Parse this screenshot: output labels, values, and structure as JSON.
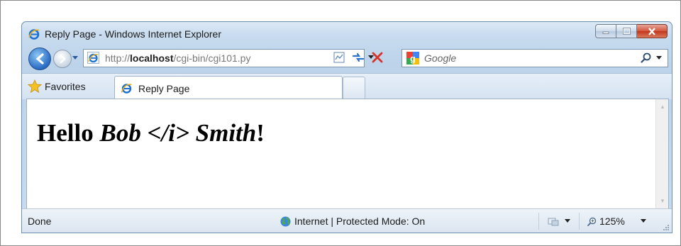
{
  "window": {
    "title": "Reply Page - Windows Internet Explorer"
  },
  "navbar": {
    "url_prefix": "http://",
    "url_host": "localhost",
    "url_path": "/cgi-bin/cgi101.py",
    "search_placeholder": "Google"
  },
  "tabs": {
    "favorites_label": "Favorites",
    "active_tab_label": "Reply Page"
  },
  "content": {
    "heading_start": "Hello ",
    "heading_italic": "Bob </i> Smith",
    "heading_end": "!"
  },
  "statusbar": {
    "status": "Done",
    "zone": "Internet | Protected Mode: On",
    "zoom": "125%"
  },
  "colors": {
    "window_border": "#6d8fb0",
    "chrome_blue": "#c8dbef",
    "close_red": "#d2563c",
    "stop_red": "#d8332b"
  }
}
